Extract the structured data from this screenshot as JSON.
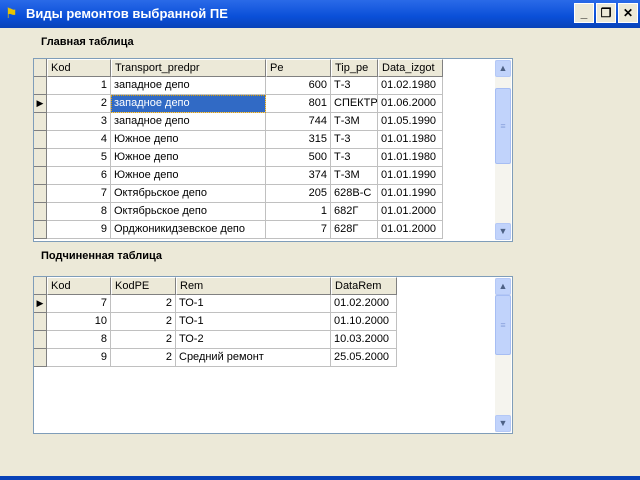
{
  "window": {
    "title": "Виды ремонтов выбранной ПЕ",
    "minimize": "_",
    "restore": "❐",
    "close": "✕"
  },
  "main": {
    "label": "Главная таблица",
    "columns": [
      "Kod",
      "Transport_predpr",
      "Pe",
      "Tip_pe",
      "Data_izgot"
    ],
    "rows": [
      [
        "1",
        "западное депо",
        "600",
        "Т-3",
        "01.02.1980"
      ],
      [
        "2",
        "западное депо",
        "801",
        "СПЕКТР",
        "01.06.2000"
      ],
      [
        "3",
        "западное депо",
        "744",
        "Т-3М",
        "01.05.1990"
      ],
      [
        "4",
        "Южное депо",
        "315",
        "Т-3",
        "01.01.1980"
      ],
      [
        "5",
        "Южное депо",
        "500",
        "Т-3",
        "01.01.1980"
      ],
      [
        "6",
        "Южное депо",
        "374",
        "Т-3М",
        "01.01.1990"
      ],
      [
        "7",
        "Октябрьское депо",
        "205",
        "628В-С",
        "01.01.1990"
      ],
      [
        "8",
        "Октябрьское депо",
        "1",
        "682Г",
        "01.01.2000"
      ],
      [
        "9",
        "Орджоникидзевское депо",
        "7",
        "628Г",
        "01.01.2000"
      ]
    ],
    "current_row": 1
  },
  "detail": {
    "label": "Подчиненная таблица",
    "columns": [
      "Kod",
      "KodPE",
      "Rem",
      "DataRem"
    ],
    "rows": [
      [
        "7",
        "2",
        "ТО-1",
        "01.02.2000"
      ],
      [
        "10",
        "2",
        "ТО-1",
        "01.10.2000"
      ],
      [
        "8",
        "2",
        "ТО-2",
        "10.03.2000"
      ],
      [
        "9",
        "2",
        "Средний ремонт",
        "25.05.2000"
      ]
    ],
    "current_row": 0
  }
}
